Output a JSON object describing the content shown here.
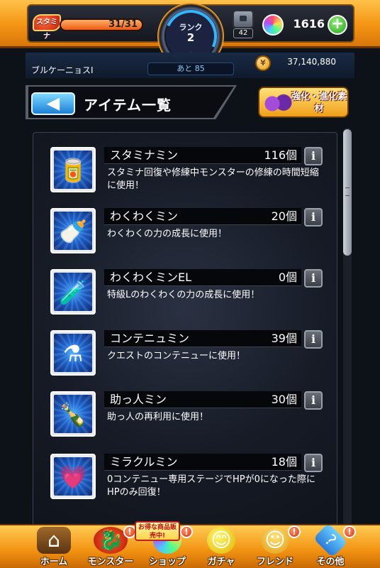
{
  "status": {
    "stamina_label": "スタミナ",
    "stamina_value": "31/31",
    "stamina_fraction": 1.0,
    "rank_label": "ランク",
    "rank_value": "2",
    "box_count": "42",
    "orb_count": "1616",
    "orb_plus": "+"
  },
  "player": {
    "name": "ブルケーニョスI",
    "exp_remaining": "あと 85",
    "coins": "37,140,880"
  },
  "header": {
    "back_label": "◀",
    "title": "アイテム一覧",
    "evolve_button_label": "強化・進化素材"
  },
  "items": [
    {
      "name": "スタミナミン",
      "count": "116個",
      "desc": "スタミナ回復や修練中モンスターの修練の時間短縮に使用！",
      "icon": "stamina-can-icon",
      "glyph": "🥫"
    },
    {
      "name": "わくわくミン",
      "count": "20個",
      "desc": "わくわくの力の成長に使用！",
      "icon": "sprout-bottle-icon",
      "glyph": "🍼"
    },
    {
      "name": "わくわくミンEL",
      "count": "0個",
      "desc": "特級Lのわくわくの力の成長に使用！",
      "icon": "sprout-bottle-el-icon",
      "glyph": "🧪"
    },
    {
      "name": "コンテニュミン",
      "count": "39個",
      "desc": "クエストのコンテニューに使用！",
      "icon": "continue-flask-icon",
      "glyph": "⚗"
    },
    {
      "name": "助っ人ミン",
      "count": "30個",
      "desc": "助っ人の再利用に使用！",
      "icon": "helper-bottle-icon",
      "glyph": "🍾"
    },
    {
      "name": "ミラクルミン",
      "count": "18個",
      "desc": "0コンテニュー専用ステージでHPが0になった際にHPのみ回復！",
      "icon": "miracle-heart-icon",
      "glyph": "💗"
    }
  ],
  "info_label": "i",
  "nav": {
    "sale_tag": "お得な商品販売中!",
    "items": [
      {
        "label": "ホーム",
        "icon": "home-icon",
        "badge": ""
      },
      {
        "label": "モンスター",
        "icon": "monster-icon",
        "badge": "!"
      },
      {
        "label": "ショップ",
        "icon": "orb-shop-icon",
        "badge": "!"
      },
      {
        "label": "ガチャ",
        "icon": "gacha-icon",
        "badge": ""
      },
      {
        "label": "フレンド",
        "icon": "friend-icon",
        "badge": "!"
      },
      {
        "label": "その他",
        "icon": "other-icon",
        "badge": "!"
      }
    ]
  },
  "colors": {
    "frame_orange": "#f39414",
    "panel_dark": "#161b26",
    "accent_blue": "#1a7fd6"
  }
}
